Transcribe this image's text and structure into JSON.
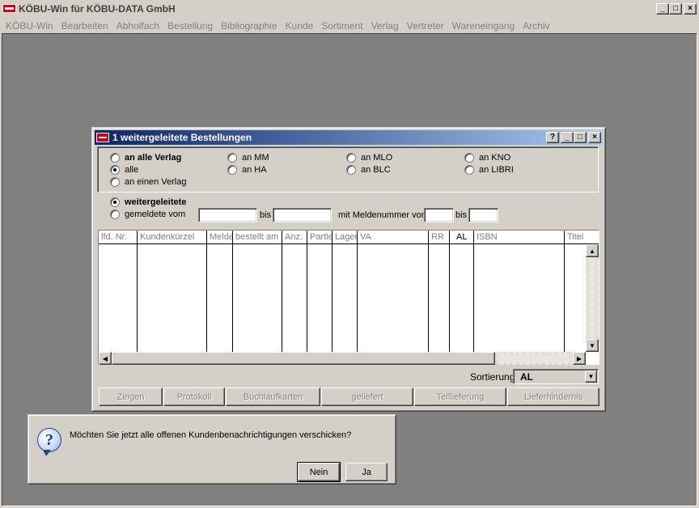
{
  "app": {
    "title": "KÖBU-Win für KÖBU-DATA GmbH",
    "logo_text": "KÖBU",
    "window_controls": [
      "_",
      "□",
      "×"
    ]
  },
  "menu": [
    "KÖBU-Win",
    "Bearbeiten",
    "Abholfach",
    "Bestellung",
    "Bibliographie",
    "Kunde",
    "Sortiment",
    "Verlag",
    "Vertreter",
    "Wareneingang",
    "Archiv"
  ],
  "child_window": {
    "title": "1 weitergeleitete Bestellungen",
    "controls": [
      "?",
      "_",
      "□",
      "×"
    ]
  },
  "filter": {
    "options": [
      {
        "label": "an alle Verlag",
        "selected": false,
        "bold": true
      },
      {
        "label": "alle",
        "selected": true,
        "bold": false
      },
      {
        "label": "an einen Verlag",
        "selected": false,
        "bold": false
      },
      {
        "label": "an MM",
        "selected": false,
        "bold": false
      },
      {
        "label": "an HA",
        "selected": false,
        "bold": false
      },
      {
        "label": "an MLO",
        "selected": false,
        "bold": false
      },
      {
        "label": "an BLC",
        "selected": false,
        "bold": false
      },
      {
        "label": "an KNO",
        "selected": false,
        "bold": false
      },
      {
        "label": "an LIBRI",
        "selected": false,
        "bold": false
      }
    ]
  },
  "status": {
    "forwarded_label": "weitergeleitete",
    "reported_label": "gemeldete vom",
    "date_from": "",
    "bis_label": "bis",
    "date_to": "",
    "number_label": "mit Meldenummer von",
    "number_from": "",
    "bis2_label": "bis",
    "number_to": ""
  },
  "table": {
    "columns": [
      "lfd. Nr.",
      "Kundenkürzel",
      "Melde",
      "bestellt am",
      "Anz.",
      "Partie",
      "Lager",
      "VA",
      "RR",
      "AL",
      "ISBN",
      "Titel"
    ],
    "rows": []
  },
  "sort": {
    "label": "Sortierung",
    "value": "AL"
  },
  "actions": [
    "Zeigen",
    "Protokoll",
    "Buchlaufkarten",
    "geliefert",
    "Teillieferung",
    "Lieferhindernis"
  ],
  "message": {
    "text": "Möchten Sie jetzt alle offenen Kundenbenachrichtigungen verschicken?",
    "no_label": "Nein",
    "yes_label": "Ja"
  }
}
